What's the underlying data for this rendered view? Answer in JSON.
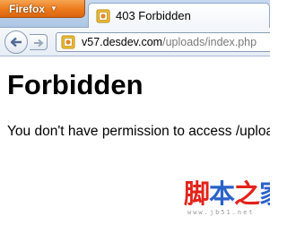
{
  "window": {
    "app_menu_label": "Firefox",
    "app_menu_caret": "▼"
  },
  "tab": {
    "title": "403 Forbidden",
    "icon": "site-favicon"
  },
  "navigation": {
    "back_icon": "back-arrow-icon",
    "forward_icon": "forward-arrow-icon",
    "url_icon": "site-identity-icon",
    "url_domain": "v57.desdev.com",
    "url_path": "/uploads/index.php"
  },
  "page": {
    "heading": "Forbidden",
    "message": "You don't have permission to access /uploads/index.php on this server."
  },
  "watermark": {
    "chars": [
      "脚",
      "本",
      "之",
      "家"
    ],
    "sub": "www.jb51.net"
  },
  "colors": {
    "app_button": "#ec7a1c",
    "titlebar": "#b9cfe9",
    "watermark_red": "#e2231a",
    "watermark_blue": "#2a62c9"
  }
}
